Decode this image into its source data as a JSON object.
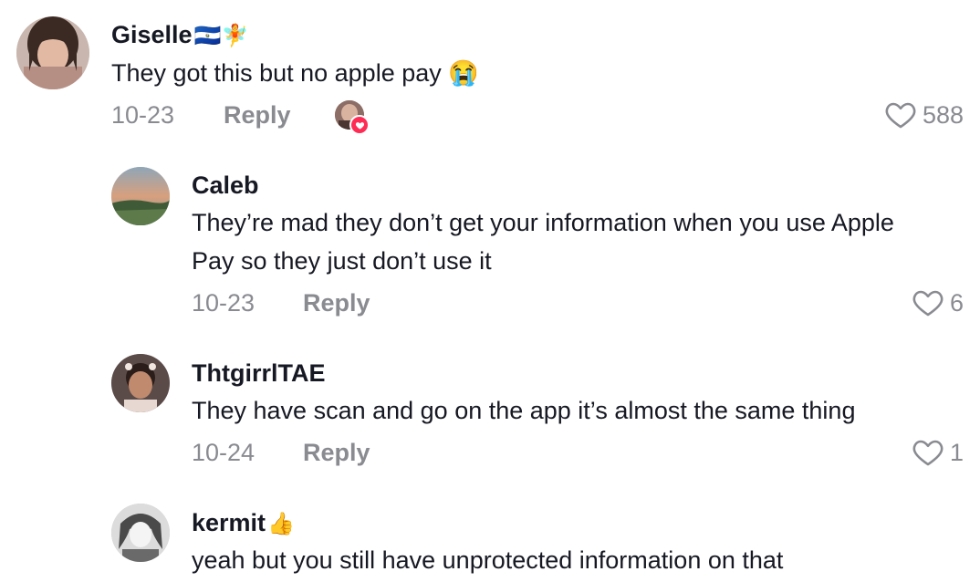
{
  "comments": [
    {
      "username": "Giselle",
      "username_emoji": "🇸🇻🧚",
      "text_lines": [
        "They got this but no apple pay 😭"
      ],
      "date": "10-23",
      "reply_label": "Reply",
      "likes": "588",
      "creator_liked": true
    },
    {
      "username": "Caleb",
      "username_emoji": "",
      "text_lines": [
        "They’re mad they don’t get your information when you use Apple",
        "Pay so they just don’t use it"
      ],
      "date": "10-23",
      "reply_label": "Reply",
      "likes": "6"
    },
    {
      "username": "ThtgirrlTAE",
      "username_emoji": "",
      "text_lines": [
        "They have scan and go on the app it’s almost the same thing"
      ],
      "date": "10-24",
      "reply_label": "Reply",
      "likes": "1"
    },
    {
      "username": "kermit",
      "username_emoji": "👍",
      "text_lines": [
        "yeah but you still have unprotected information on that"
      ]
    }
  ],
  "icons": {
    "like": "heart-outline-icon",
    "creator_like": "heart-badge-icon"
  },
  "colors": {
    "text": "#161823",
    "muted": "#8a8b91",
    "accent": "#fe2c55"
  }
}
